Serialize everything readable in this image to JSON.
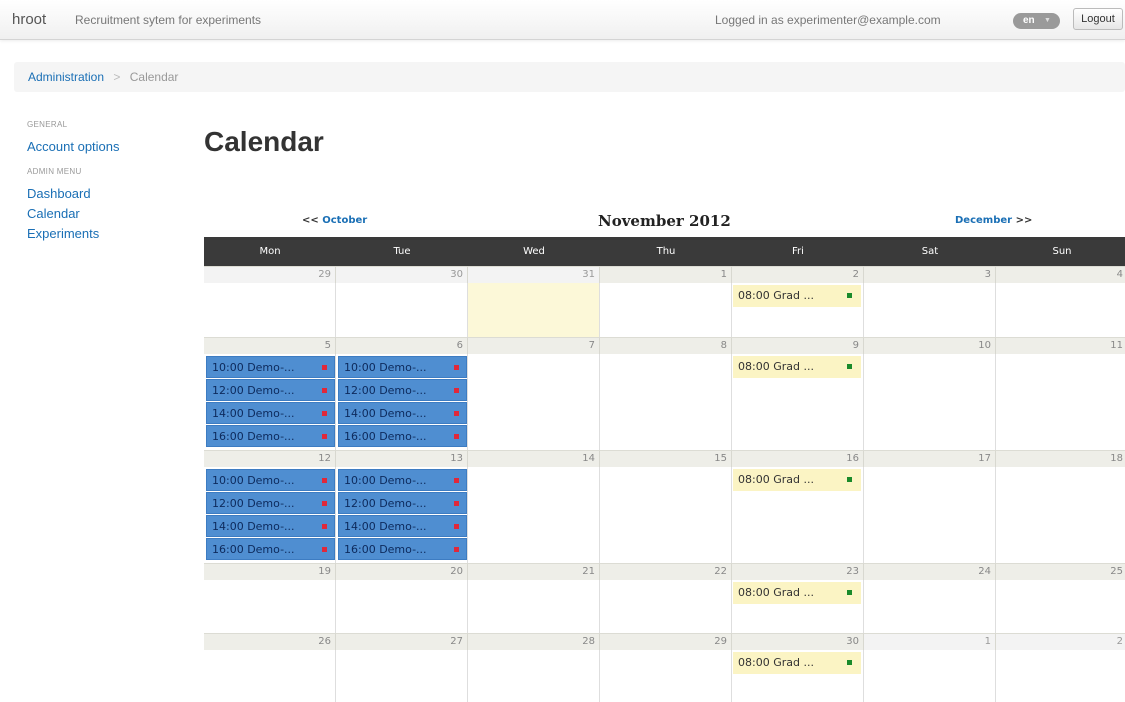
{
  "header": {
    "brand": "hroot",
    "tagline": "Recruitment sytem for experiments",
    "logged_in": "Logged in as experimenter@example.com",
    "language": "en",
    "logout_label": "Logout"
  },
  "breadcrumb": {
    "parent": "Administration",
    "separator": ">",
    "current": "Calendar"
  },
  "sidebar": {
    "general_header": "GENERAL",
    "account_options": "Account options",
    "admin_header": "ADMIN MENU",
    "dashboard": "Dashboard",
    "calendar": "Calendar",
    "experiments": "Experiments"
  },
  "page": {
    "title": "Calendar"
  },
  "calendar": {
    "prev_arrows": "<<",
    "prev_month": "October",
    "next_month": "December",
    "next_arrows": ">>",
    "current_month": "November 2012",
    "weekdays": [
      "Mon",
      "Tue",
      "Wed",
      "Thu",
      "Fri",
      "Sat",
      "Sun"
    ],
    "weeks": [
      {
        "days": [
          "29",
          "30",
          "31",
          "1",
          "2",
          "3",
          "4"
        ],
        "events": [
          {
            "day": 4,
            "label": "08:00 Grad ...",
            "type": "yellow"
          }
        ]
      },
      {
        "days": [
          "5",
          "6",
          "7",
          "8",
          "9",
          "10",
          "11"
        ],
        "events": [
          {
            "day": 0,
            "label": "10:00 Demo-...",
            "type": "blue"
          },
          {
            "day": 0,
            "label": "12:00 Demo-...",
            "type": "blue"
          },
          {
            "day": 0,
            "label": "14:00 Demo-...",
            "type": "blue"
          },
          {
            "day": 0,
            "label": "16:00 Demo-...",
            "type": "blue"
          },
          {
            "day": 1,
            "label": "10:00 Demo-...",
            "type": "blue"
          },
          {
            "day": 1,
            "label": "12:00 Demo-...",
            "type": "blue"
          },
          {
            "day": 1,
            "label": "14:00 Demo-...",
            "type": "blue"
          },
          {
            "day": 1,
            "label": "16:00 Demo-...",
            "type": "blue"
          },
          {
            "day": 4,
            "label": "08:00 Grad ...",
            "type": "yellow"
          }
        ]
      },
      {
        "days": [
          "12",
          "13",
          "14",
          "15",
          "16",
          "17",
          "18"
        ],
        "events": [
          {
            "day": 0,
            "label": "10:00 Demo-...",
            "type": "blue"
          },
          {
            "day": 0,
            "label": "12:00 Demo-...",
            "type": "blue"
          },
          {
            "day": 0,
            "label": "14:00 Demo-...",
            "type": "blue"
          },
          {
            "day": 0,
            "label": "16:00 Demo-...",
            "type": "blue"
          },
          {
            "day": 1,
            "label": "10:00 Demo-...",
            "type": "blue"
          },
          {
            "day": 1,
            "label": "12:00 Demo-...",
            "type": "blue"
          },
          {
            "day": 1,
            "label": "14:00 Demo-...",
            "type": "blue"
          },
          {
            "day": 1,
            "label": "16:00 Demo-...",
            "type": "blue"
          },
          {
            "day": 4,
            "label": "08:00 Grad ...",
            "type": "yellow"
          }
        ]
      },
      {
        "days": [
          "19",
          "20",
          "21",
          "22",
          "23",
          "24",
          "25"
        ],
        "events": [
          {
            "day": 4,
            "label": "08:00 Grad ...",
            "type": "yellow"
          }
        ]
      },
      {
        "days": [
          "26",
          "27",
          "28",
          "29",
          "30",
          "1",
          "2"
        ],
        "events": [
          {
            "day": 4,
            "label": "08:00 Grad ...",
            "type": "yellow"
          }
        ]
      }
    ],
    "colors": {
      "blue_event": "#4f8ed1",
      "yellow_event": "#fbf4c4",
      "red_dot": "#e0283a",
      "green_dot": "#1a8a2a"
    }
  }
}
